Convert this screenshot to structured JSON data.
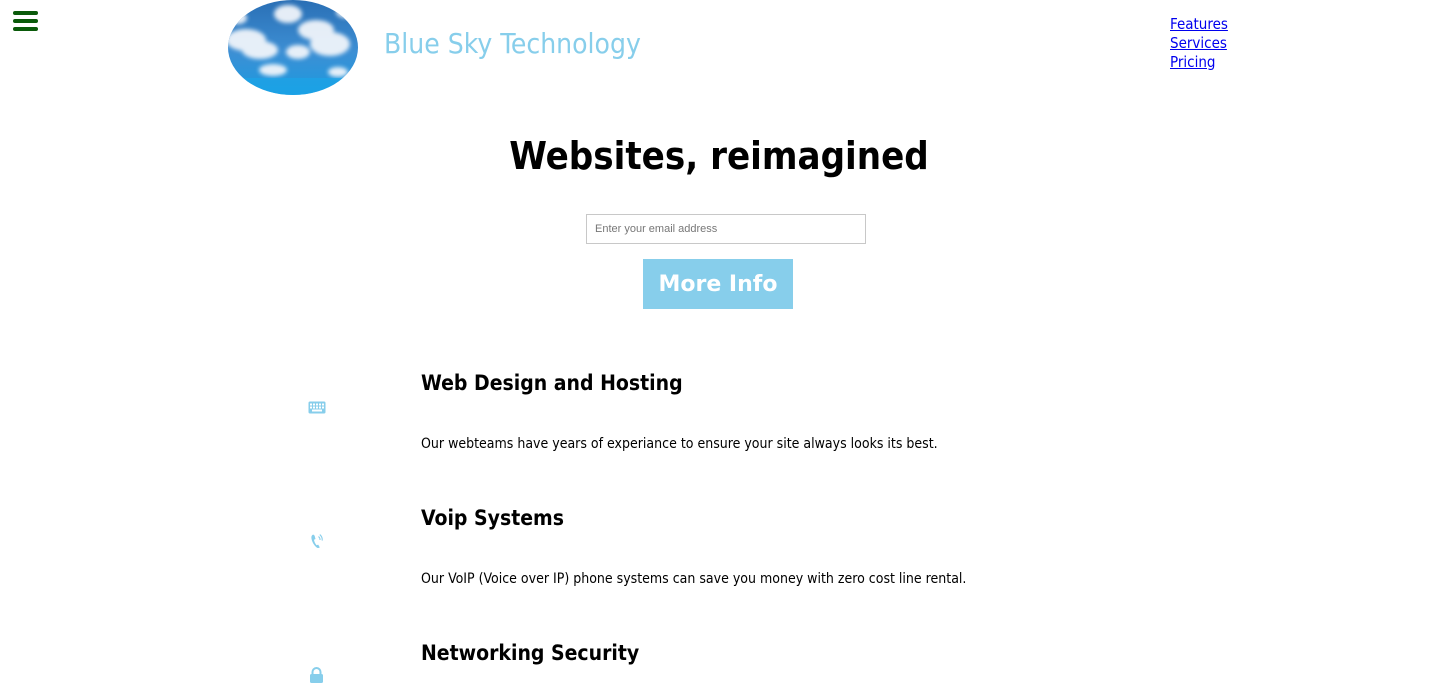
{
  "header": {
    "brand": "Blue Sky Technology",
    "nav": [
      {
        "label": "Features"
      },
      {
        "label": "Services"
      },
      {
        "label": "Pricing"
      }
    ]
  },
  "hero": {
    "title": "Websites, reimagined",
    "email_placeholder": "Enter your email address",
    "button_label": "More Info"
  },
  "features": [
    {
      "icon": "keyboard-icon",
      "title": "Web Design and Hosting",
      "text": "Our webteams have years of experiance to ensure your site always looks its best."
    },
    {
      "icon": "phone-icon",
      "title": "Voip Systems",
      "text": "Our VoIP (Voice over IP) phone systems can save you money with zero cost line rental."
    },
    {
      "icon": "lock-icon",
      "title": "Networking Security",
      "text": ""
    }
  ],
  "colors": {
    "brand": "#87ceeb",
    "menu_icon": "#0a5a0a",
    "link": "#0000ee",
    "button_bg": "#87ceeb"
  }
}
